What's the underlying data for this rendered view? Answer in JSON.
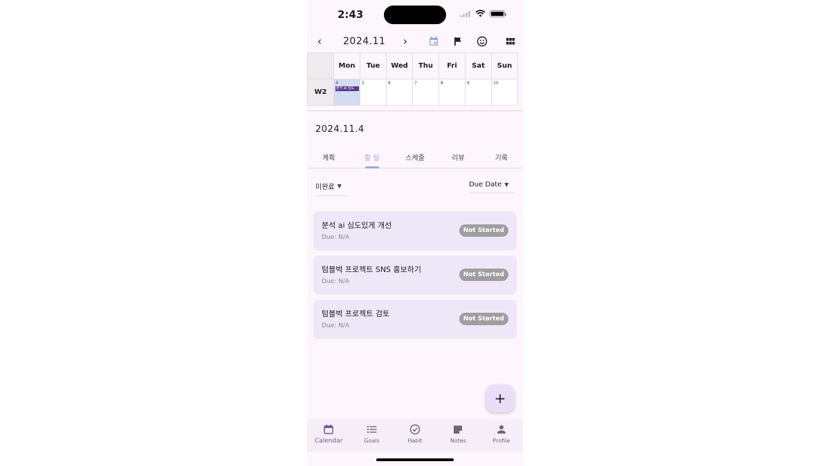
{
  "status": {
    "time": "2:43"
  },
  "header": {
    "month": "2024.11",
    "prev_icon": "chevron-left-icon",
    "next_icon": "chevron-right-icon",
    "accent": "#9aa8da"
  },
  "week": {
    "days": [
      "Mon",
      "Tue",
      "Wed",
      "Thu",
      "Fri",
      "Sat",
      "Sun"
    ],
    "week_label": "W2",
    "dates": [
      "4",
      "5",
      "6",
      "7",
      "8",
      "9",
      "10"
    ],
    "event_label": "분석 ai 심도"
  },
  "selected_date": "2024.11.4",
  "tabs": [
    "계획",
    "할 일",
    "스케줄",
    "리뷰",
    "기록"
  ],
  "active_tab": "할 일",
  "filters": {
    "status": "미완료",
    "sort": "Due Date"
  },
  "tasks": [
    {
      "title": "분석 ai 심도있게 개선",
      "due": "Due: N/A",
      "status": "Not Started"
    },
    {
      "title": "텀블벅 프로젝트 SNS 홍보하기",
      "due": "Due: N/A",
      "status": "Not Started"
    },
    {
      "title": "텀블벅 프로젝트 검토",
      "due": "Due: N/A",
      "status": "Not Started"
    }
  ],
  "fab": {
    "label": "+"
  },
  "nav": [
    {
      "label": "Calendar",
      "icon": "calendar-icon"
    },
    {
      "label": "Goals",
      "icon": "list-icon"
    },
    {
      "label": "Habit",
      "icon": "check-circle-icon"
    },
    {
      "label": "Notes",
      "icon": "note-icon"
    },
    {
      "label": "Profile",
      "icon": "person-icon"
    }
  ]
}
